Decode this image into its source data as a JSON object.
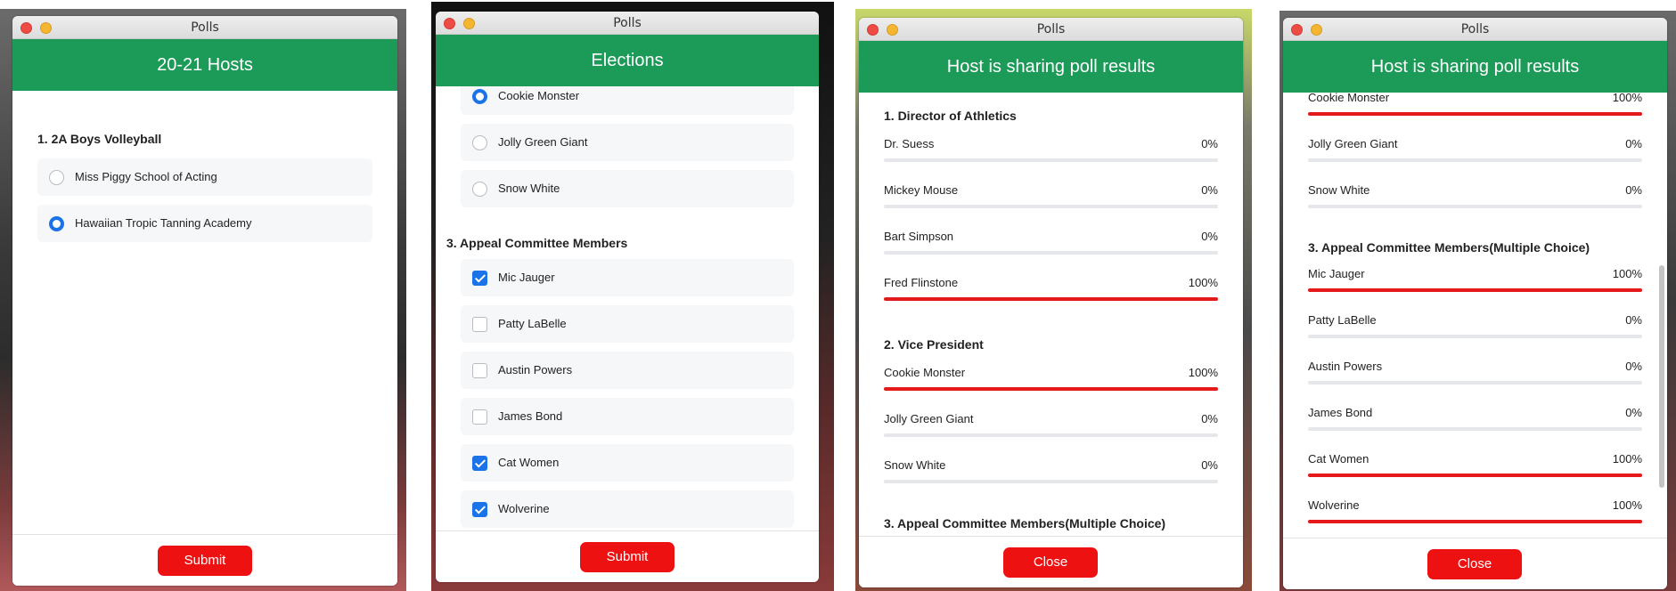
{
  "colors": {
    "banner": "#1c9a57",
    "button": "#ee1111",
    "radio_selected": "#1a73e8",
    "checkbox_selected": "#1a73e8",
    "bar_fill": "#e51a1a",
    "bar_track": "#e6e7ea"
  },
  "window1": {
    "title": "Polls",
    "banner": "20-21 Hosts",
    "question": "1. 2A Boys Volleyball",
    "options": [
      {
        "label": "Miss Piggy School of Acting",
        "selected": false
      },
      {
        "label": "Hawaiian Tropic Tanning Academy",
        "selected": true
      }
    ],
    "button": "Submit"
  },
  "window2": {
    "title": "Polls",
    "banner": "Elections",
    "q2_options": [
      {
        "label": "Cookie Monster",
        "selected": true
      },
      {
        "label": "Jolly Green Giant",
        "selected": false
      },
      {
        "label": "Snow White",
        "selected": false
      }
    ],
    "q3_title": "3. Appeal Committee Members",
    "q3_options": [
      {
        "label": "Mic Jauger",
        "checked": true
      },
      {
        "label": "Patty LaBelle",
        "checked": false
      },
      {
        "label": "Austin Powers",
        "checked": false
      },
      {
        "label": "James Bond",
        "checked": false
      },
      {
        "label": "Cat Women",
        "checked": true
      },
      {
        "label": "Wolverine",
        "checked": true
      }
    ],
    "button": "Submit"
  },
  "window3": {
    "title": "Polls",
    "banner": "Host is sharing poll results",
    "q1_title": "1. Director of Athletics",
    "q1_results": [
      {
        "name": "Dr. Suess",
        "pct": "0%",
        "value": 0
      },
      {
        "name": "Mickey Mouse",
        "pct": "0%",
        "value": 0
      },
      {
        "name": "Bart Simpson",
        "pct": "0%",
        "value": 0
      },
      {
        "name": "Fred Flinstone",
        "pct": "100%",
        "value": 100
      }
    ],
    "q2_title": "2. Vice President",
    "q2_results": [
      {
        "name": "Cookie Monster",
        "pct": "100%",
        "value": 100
      },
      {
        "name": "Jolly Green Giant",
        "pct": "0%",
        "value": 0
      },
      {
        "name": "Snow White",
        "pct": "0%",
        "value": 0
      }
    ],
    "q3_title": "3. Appeal Committee Members(Multiple Choice)",
    "button": "Close"
  },
  "window4": {
    "title": "Polls",
    "banner": "Host is sharing poll results",
    "q2_results": [
      {
        "name": "Cookie Monster",
        "pct": "100%",
        "value": 100
      },
      {
        "name": "Jolly Green Giant",
        "pct": "0%",
        "value": 0
      },
      {
        "name": "Snow White",
        "pct": "0%",
        "value": 0
      }
    ],
    "q3_title": "3. Appeal Committee Members(Multiple Choice)",
    "q3_results": [
      {
        "name": "Mic Jauger",
        "pct": "100%",
        "value": 100
      },
      {
        "name": "Patty LaBelle",
        "pct": "0%",
        "value": 0
      },
      {
        "name": "Austin Powers",
        "pct": "0%",
        "value": 0
      },
      {
        "name": "James Bond",
        "pct": "0%",
        "value": 0
      },
      {
        "name": "Cat Women",
        "pct": "100%",
        "value": 100
      },
      {
        "name": "Wolverine",
        "pct": "100%",
        "value": 100
      }
    ],
    "button": "Close"
  }
}
